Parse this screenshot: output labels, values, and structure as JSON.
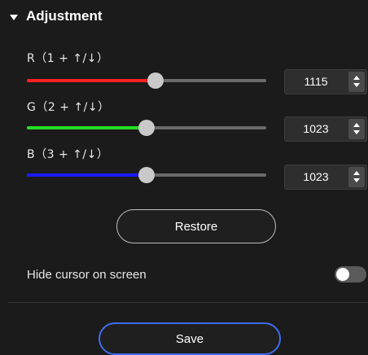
{
  "section": {
    "title": "Adjustment"
  },
  "channels": [
    {
      "label": "R（1 + ↑/↓）",
      "value": "1115",
      "fill_color": "#ff2020",
      "level": 0.537
    },
    {
      "label": "G（2 + ↑/↓）",
      "value": "1023",
      "fill_color": "#22e022",
      "level": 0.5
    },
    {
      "label": "B（3 + ↑/↓）",
      "value": "1023",
      "fill_color": "#1a1aff",
      "level": 0.5
    }
  ],
  "restore_label": "Restore",
  "hide_cursor": {
    "label": "Hide cursor on screen",
    "enabled": false
  },
  "save_label": "Save"
}
